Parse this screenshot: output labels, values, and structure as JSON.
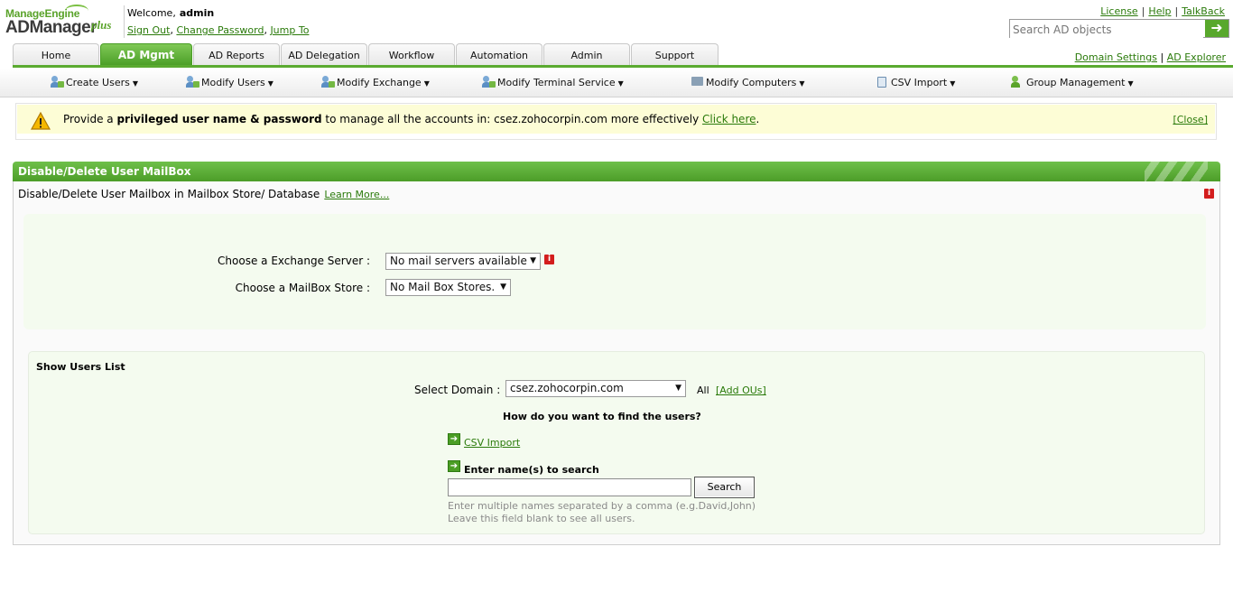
{
  "brand": {
    "company": "ManageEngine",
    "product": "ADManager",
    "edition": "plus"
  },
  "header": {
    "welcome_label": "Welcome,",
    "username": "admin",
    "sign_out": "Sign Out",
    "change_password": "Change Password",
    "jump_to": "Jump To",
    "license": "License",
    "help": "Help",
    "talkback": "TalkBack",
    "search_placeholder": "Search AD objects",
    "domain_settings": "Domain Settings",
    "ad_explorer": "AD Explorer"
  },
  "tabs": [
    "Home",
    "AD Mgmt",
    "AD Reports",
    "AD Delegation",
    "Workflow",
    "Automation",
    "Admin",
    "Support"
  ],
  "active_tab": "AD Mgmt",
  "menu": [
    "Create Users",
    "Modify Users",
    "Modify Exchange",
    "Modify Terminal Service",
    "Modify Computers",
    "CSV Import",
    "Group Management"
  ],
  "notice": {
    "prefix": "Provide a ",
    "bold": "privileged user name & password",
    "middle": " to manage all the accounts in: csez.zohocorpin.com more effectively ",
    "link": "Click here",
    "suffix": ".",
    "close": "[Close]"
  },
  "panel": {
    "title": "Disable/Delete User MailBox",
    "subtitle": "Disable/Delete User Mailbox in Mailbox Store/ Database",
    "learn_more": "Learn More...",
    "exchange_label": "Choose a Exchange Server :",
    "exchange_value": "No mail servers available",
    "store_label": "Choose a MailBox Store :",
    "store_value": "No Mail Box Stores.",
    "show_users": "Show Users List",
    "domain_label": "Select Domain :",
    "domain_value": "csez.zohocorpin.com",
    "all_label": "All",
    "add_ous": "[Add OUs]",
    "find_question": "How do you want to find the users?",
    "csv_import": "CSV Import",
    "enter_names": "Enter name(s) to search",
    "search_button": "Search",
    "hint1": "Enter multiple names separated by a comma (e.g.David,John)",
    "hint2": "Leave this field blank to see all users."
  },
  "colors": {
    "accent": "#5aaa30",
    "link": "#2a7a0a",
    "notice_bg": "#fdfdd6",
    "info_red": "#d31d1d"
  }
}
